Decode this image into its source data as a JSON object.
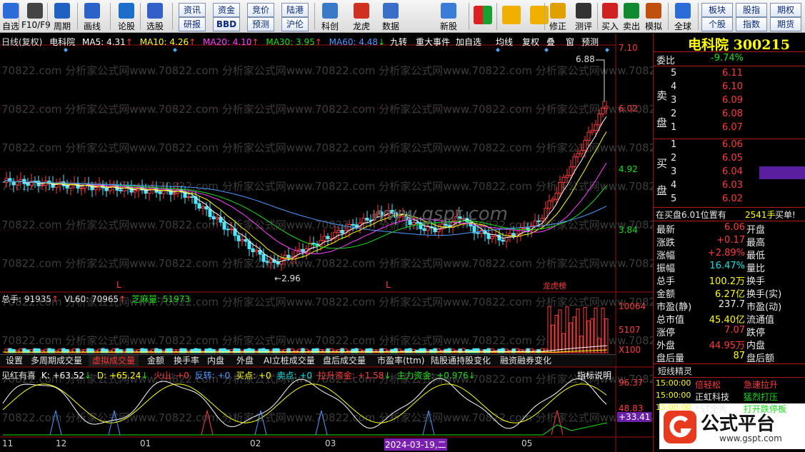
{
  "toolbar": {
    "items": [
      "自选",
      "F10/F9",
      "周期",
      "画线",
      "论股",
      "选股",
      "资讯",
      "资金",
      "竞价",
      "陆港",
      "研报",
      "BBD",
      "预测",
      "沪伦",
      "科创",
      "龙虎",
      "数据",
      "新股",
      "修正",
      "测评",
      "买入",
      "卖出",
      "模拟",
      "全球",
      "板块",
      "股指",
      "期权",
      "个股",
      "指数",
      "期货"
    ]
  },
  "chart": {
    "title": "日线(复权)",
    "stock_short": "电科院",
    "ma5": "MA5: 4.31",
    "ma10": "MA10: 4.26",
    "ma20": "MA20: 4.10",
    "ma30": "MA30: 3.95",
    "ma60": "MA60: 4.48",
    "menu": [
      "九转",
      "重大事件",
      "加自选",
      "均线",
      "复权",
      "叠",
      "窗",
      "预测"
    ],
    "price_axis": [
      "7.10",
      "6.02",
      "4.92",
      "3.84"
    ],
    "high_label": "6.88",
    "low_label": "2.96",
    "marker_l": "L",
    "marker_rank": "龙虎榜",
    "watermark": "70822.com 分析家公式网www.70822.com 分析家公式网www.70822.com 分析家公式网www.70822.com 分析家公式网www.70822.com 分析家公式网",
    "logo": "www.gspt.com"
  },
  "volume": {
    "total": "总手: 91935",
    "vl60": "VL60: 70965",
    "zhima": "芝麻量: 51973",
    "axis": [
      "10064",
      "5107",
      "X100"
    ]
  },
  "tabs": [
    "设置",
    "多周期成交量",
    "虚拟成交量",
    "金额",
    "换手率",
    "内盘",
    "外盘",
    "AI立桩成交量",
    "盘后成交量",
    "市盈率(ttm)",
    "陆股通持股变化",
    "融资融券变化"
  ],
  "indicator": {
    "name": "见红有喜",
    "k": "K: +63.52",
    "d": "D: +65.24",
    "huoshan": "火山: +0",
    "fanzhuan": "反转: +0",
    "buy": "买点: +0",
    "sell": "卖点: +0",
    "lasheng": "拉升资金: +1.58",
    "zhuli": "主力资金: +0.976",
    "button": "指标说明",
    "axis": [
      "96.37",
      "48.83",
      "+33.41"
    ]
  },
  "dates": [
    "11",
    "12",
    "01",
    "02",
    "03",
    "2024-03-19,二",
    "05"
  ],
  "side": {
    "title": "电科院 300215",
    "weibi_label": "委比",
    "weibi_value": "-9.74%",
    "sell_label": [
      "卖",
      "盘"
    ],
    "buy_label": [
      "买",
      "盘"
    ],
    "asks": [
      {
        "n": "5",
        "p": "6.11"
      },
      {
        "n": "4",
        "p": "6.10"
      },
      {
        "n": "3",
        "p": "6.09"
      },
      {
        "n": "2",
        "p": "6.08"
      },
      {
        "n": "1",
        "p": "6.07"
      }
    ],
    "bids": [
      {
        "n": "1",
        "p": "6.06"
      },
      {
        "n": "2",
        "p": "6.05"
      },
      {
        "n": "3",
        "p": "6.04"
      },
      {
        "n": "4",
        "p": "6.03"
      },
      {
        "n": "5",
        "p": "6.02"
      }
    ],
    "order_note": "在买盘6.01位置有",
    "order_qty": "2541手",
    "order_tag": "买单!",
    "stats": [
      {
        "l1": "最新",
        "v1": "6.06",
        "l2": "开盘",
        "v2": ""
      },
      {
        "l1": "涨跌",
        "v1": "+0.17",
        "l2": "最高",
        "v2": ""
      },
      {
        "l1": "涨幅",
        "v1": "+2.89%",
        "l2": "最低",
        "v2": ""
      },
      {
        "l1": "振幅",
        "v1": "16.47%",
        "l2": "量比",
        "v2": ""
      },
      {
        "l1": "总手",
        "v1": "100.2万",
        "l2": "换手",
        "v2": ""
      },
      {
        "l1": "金额",
        "v1": "6.27亿",
        "l2": "换手(实)",
        "v2": ""
      },
      {
        "l1": "市盈(静)",
        "v1": "237.7",
        "l2": "市盈(动)",
        "v2": ""
      },
      {
        "l1": "总市值",
        "v1": "45.40亿",
        "l2": "流通值",
        "v2": ""
      },
      {
        "l1": "涨停",
        "v1": "7.07",
        "l2": "跌停",
        "v2": ""
      },
      {
        "l1": "外盘",
        "v1": "44.95万",
        "l2": "内盘",
        "v2": ""
      },
      {
        "l1": "盘后量",
        "v1": "87",
        "l2": "盘后额",
        "v2": ""
      }
    ],
    "news_title": "短线精灵",
    "news": [
      {
        "time": "15:00:00",
        "name": "倍轻松",
        "event": "急速拉升"
      },
      {
        "time": "15:00:00",
        "name": "正虹科技",
        "event": "猛烈打压"
      },
      {
        "time": "15:00:00",
        "name": "*ST全秀",
        "event": "打开跌停板"
      }
    ],
    "brand": "公式平台",
    "brand_url": "www.gspt.com"
  }
}
